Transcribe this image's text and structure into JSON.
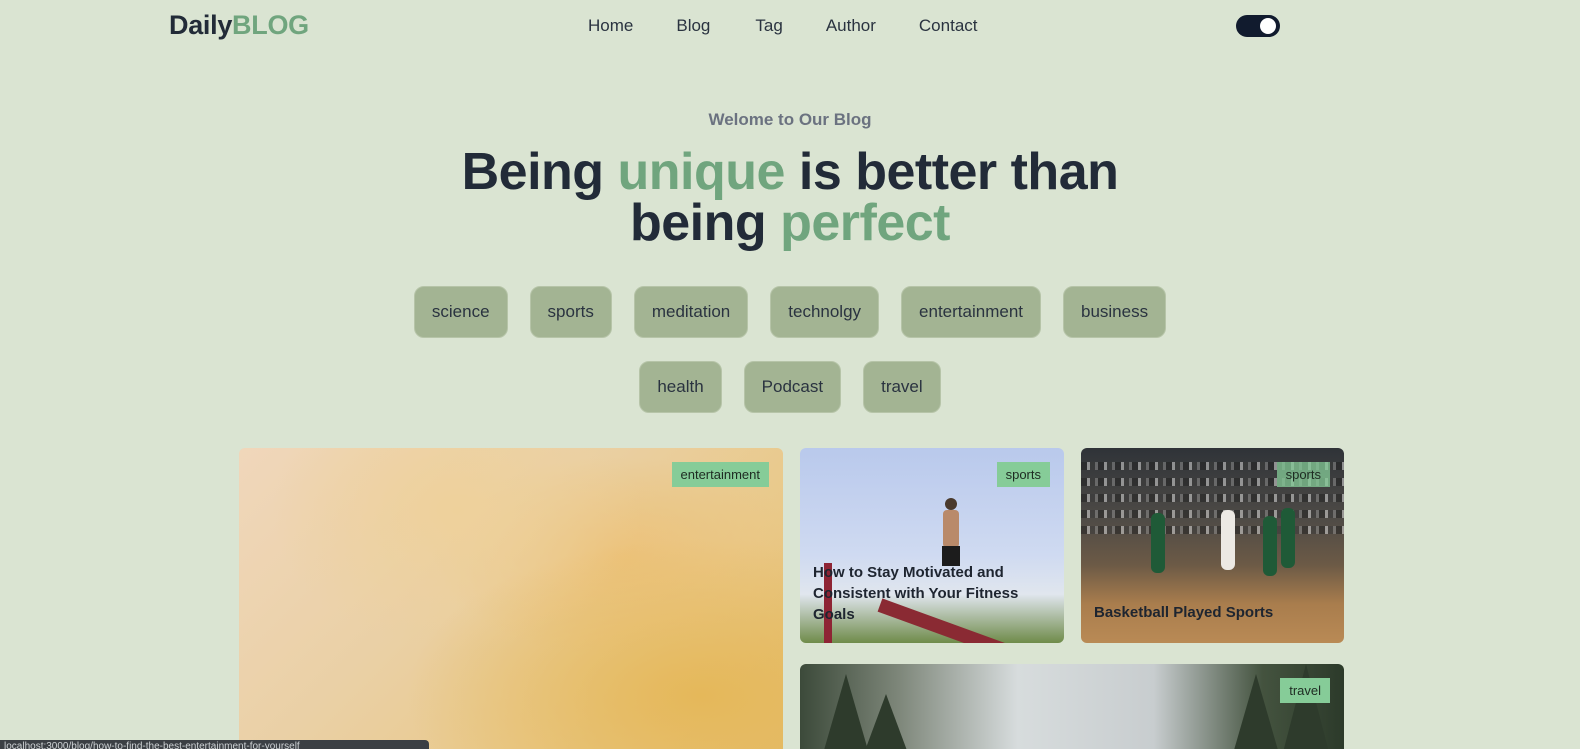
{
  "header": {
    "logo_part1": "Daily",
    "logo_part2": "BLOG",
    "nav": [
      "Home",
      "Blog",
      "Tag",
      "Author",
      "Contact"
    ],
    "theme_toggle": "on"
  },
  "hero": {
    "welcome": "Welome to Our Blog",
    "headline": {
      "w1": "Being ",
      "w2": "unique",
      "w3": " is better than",
      "w4": "being ",
      "w5": "perfect"
    }
  },
  "tags": [
    "science",
    "sports",
    "meditation",
    "technolgy",
    "entertainment",
    "business",
    "health",
    "Podcast",
    "travel"
  ],
  "posts": [
    {
      "badge": "entertainment",
      "title": ""
    },
    {
      "badge": "sports",
      "title": "How to Stay Motivated and Consistent with Your Fitness Goals"
    },
    {
      "badge": "sports",
      "title": "Basketball Played Sports"
    },
    {
      "badge": "travel",
      "title": ""
    }
  ],
  "status_bar": "localhost:3000/blog/how-to-find-the-best-entertainment-for-yourself",
  "colors": {
    "accent": "#70a57e",
    "background": "#dae4d2",
    "tag_pill": "#a3b493",
    "badge": "#86cc98",
    "toggle": "#111b2e"
  }
}
